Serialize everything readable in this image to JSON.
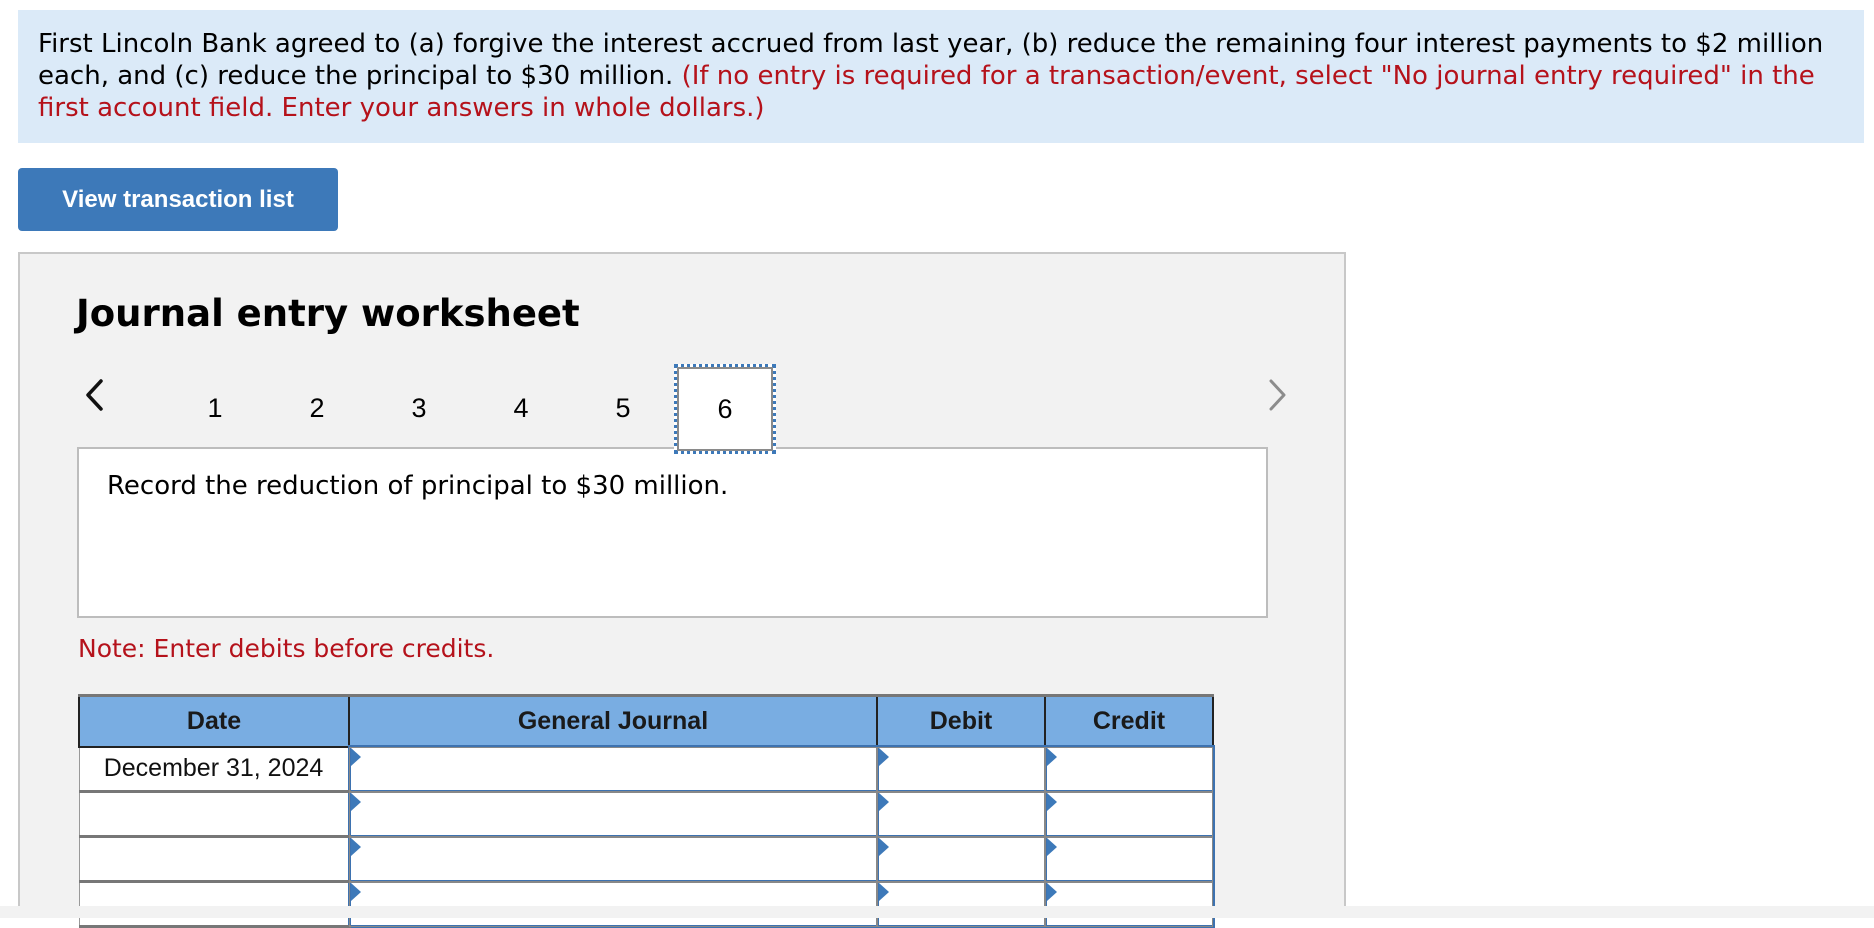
{
  "question": {
    "text": "First Lincoln Bank agreed to (a) forgive the interest accrued from last year, (b) reduce the remaining four interest payments to $2 million each, and (c) reduce the principal to $30 million.",
    "instruction": "(If no entry is required for a transaction/event, select \"No journal entry required\" in the first account field. Enter your answers in whole dollars.)"
  },
  "view_transaction_button": "View transaction list",
  "worksheet": {
    "title": "Journal entry worksheet",
    "prev_icon": "chevron-left-icon",
    "next_icon": "chevron-right-icon",
    "tabs": [
      "1",
      "2",
      "3",
      "4",
      "5",
      "6"
    ],
    "active_tab": "6",
    "prompt": "Record the reduction of principal to $30 million.",
    "note": "Note: Enter debits before credits.",
    "table": {
      "headers": [
        "Date",
        "General Journal",
        "Debit",
        "Credit"
      ],
      "rows": [
        {
          "date": "December 31, 2024",
          "account": "",
          "debit": "",
          "credit": ""
        },
        {
          "date": "",
          "account": "",
          "debit": "",
          "credit": ""
        },
        {
          "date": "",
          "account": "",
          "debit": "",
          "credit": ""
        },
        {
          "date": "",
          "account": "",
          "debit": "",
          "credit": ""
        }
      ]
    }
  },
  "colors": {
    "accent": "#3d79b9",
    "question_bg": "#dbeaf8",
    "instruction_red": "#b5121b",
    "table_header_bg": "#79ade2",
    "panel_bg": "#f2f2f2"
  }
}
